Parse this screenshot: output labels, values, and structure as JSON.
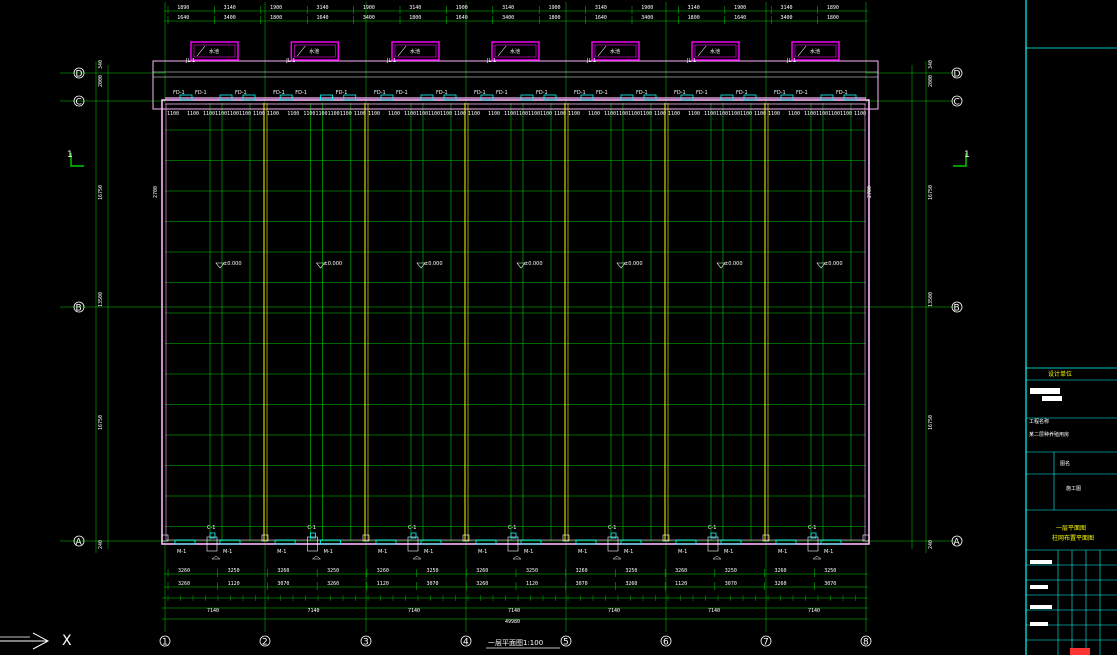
{
  "colors": {
    "background": "#000000",
    "grid": "#00cc00",
    "wall": "#ffb6ff",
    "partition": "#ffff00",
    "window": "#00ffff",
    "magenta": "#ff00ff",
    "text": "#ffffff",
    "titleblock": "#00ffff"
  },
  "drawing_title": "一层平面图1:100",
  "axes_x": [
    "1",
    "2",
    "3",
    "4",
    "5",
    "6",
    "7",
    "8"
  ],
  "axes_y": [
    "A",
    "B",
    "C",
    "D"
  ],
  "top_dims": {
    "row1": [
      "1890",
      "3140",
      "1900",
      "3140",
      "1900",
      "3140",
      "1900",
      "3140",
      "1900",
      "3140",
      "1900",
      "3140",
      "1900",
      "3140",
      "1890"
    ],
    "row2": [
      "1640",
      "3400",
      "1800",
      "1640",
      "3400",
      "1800",
      "1640",
      "3400",
      "1800",
      "1640",
      "3400",
      "1800",
      "1640",
      "3400",
      "1800"
    ]
  },
  "bottom_dims": {
    "row1": [
      "3260",
      "3250",
      "3260",
      "3250",
      "3260",
      "3250",
      "3260",
      "3250",
      "3260",
      "3250",
      "3260",
      "3250",
      "3260",
      "3250"
    ],
    "row2": [
      "3260",
      "1120",
      "3070",
      "3260",
      "1120",
      "3070",
      "3260",
      "1120",
      "3070",
      "3260",
      "1120",
      "3070",
      "3260",
      "3070"
    ],
    "bay": [
      "7140",
      "7140",
      "7140",
      "7140",
      "7140",
      "7140",
      "7140"
    ],
    "total": "49980"
  },
  "side_dims": {
    "left": [
      "340",
      "2000",
      "16750",
      "13500",
      "16750",
      "240"
    ],
    "right": [
      "340",
      "2000",
      "16750",
      "13500",
      "16750",
      "240"
    ]
  },
  "labels": {
    "water_tank": "水池",
    "elevation": "±0.000",
    "window_code": "C-1",
    "door_code": "M-1",
    "fan_code": "FD-1",
    "vent_code": "JL-1"
  },
  "section_mark": "1",
  "north_mark": "X",
  "title_block": {
    "company": "设计单位",
    "project_label": "工程名称",
    "project_name": "某二层种养殖用房",
    "drawing_label": "图名",
    "design_stage": "施工图",
    "sheet_title_1": "一层平面图",
    "sheet_title_2": "柱网布置平面图"
  }
}
